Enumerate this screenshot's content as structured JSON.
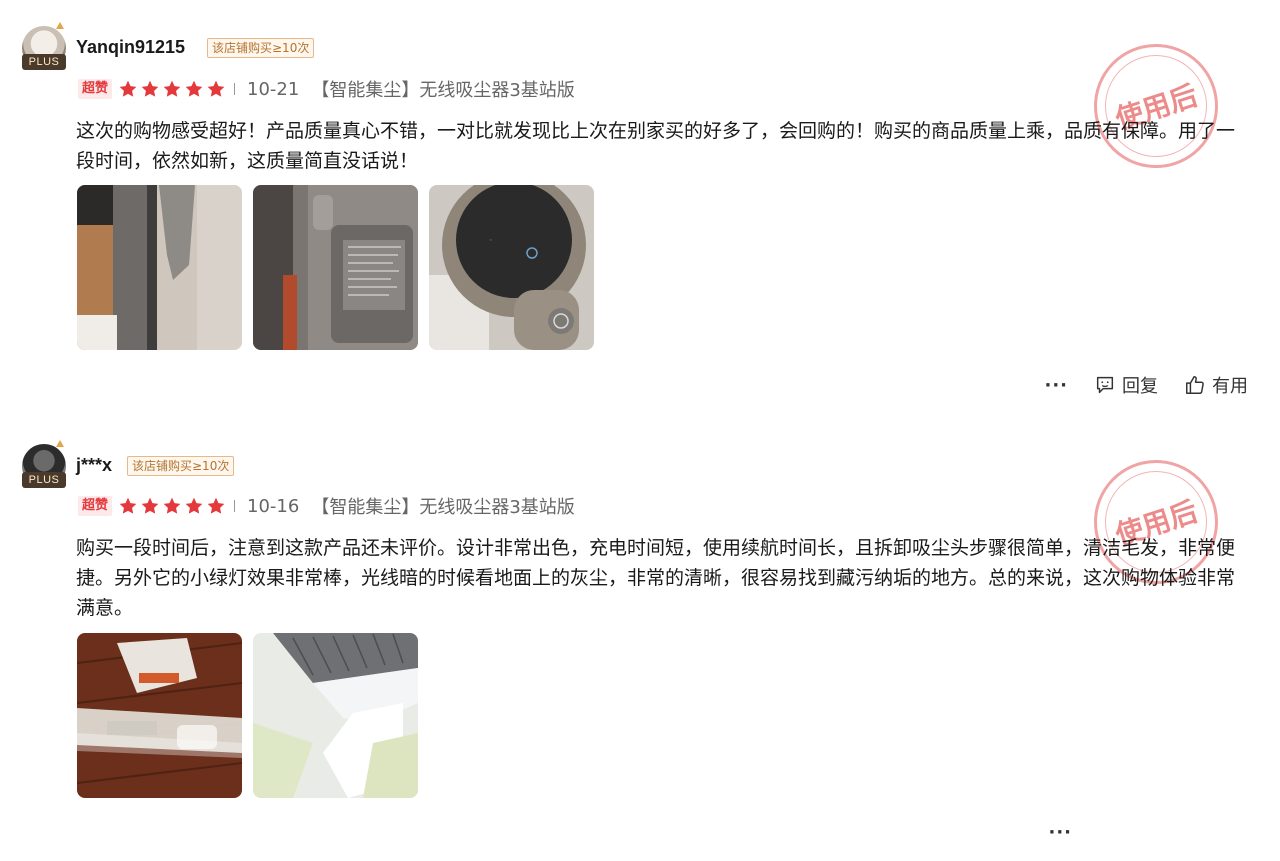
{
  "reviews": [
    {
      "username": "Yanqin91215",
      "buy_tag": "该店铺购买≥10次",
      "plus_label": "PLUS",
      "super_label": "超赞",
      "stars": 5,
      "date": "10-21",
      "product": "【智能集尘】无线吸尘器3基站版",
      "content": "这次的购物感受超好！产品质量真心不错，一对比就发现比上次在别家买的好多了，会回购的！购买的商品质量上乘，品质有保障。用了一段时间，依然如新，这质量简直没话说！",
      "stamp": "使用后",
      "photos": [
        "vacuum-side-photo",
        "vacuum-battery-label-photo",
        "vacuum-display-photo"
      ],
      "actions": {
        "more": "···",
        "reply": "回复",
        "useful": "有用"
      }
    },
    {
      "username": "j***x",
      "buy_tag": "该店铺购买≥10次",
      "plus_label": "PLUS",
      "super_label": "超赞",
      "stars": 5,
      "date": "10-16",
      "product": "【智能集尘】无线吸尘器3基站版",
      "content": "购买一段时间后，注意到这款产品还未评价。设计非常出色，充电时间短，使用续航时间长，且拆卸吸尘头步骤很简单，清洁毛发，非常便捷。另外它的小绿灯效果非常棒，光线暗的时候看地面上的灰尘，非常的清晰，很容易找到藏污纳垢的地方。总的来说，这次购物体验非常满意。",
      "stamp": "使用后",
      "photos": [
        "accessories-photo",
        "brush-head-photo"
      ],
      "actions": {
        "more": "···"
      }
    }
  ],
  "colors": {
    "star": "#e4393c",
    "super_tag_bg": "#fde9ea",
    "stamp": "#e55a5a"
  }
}
